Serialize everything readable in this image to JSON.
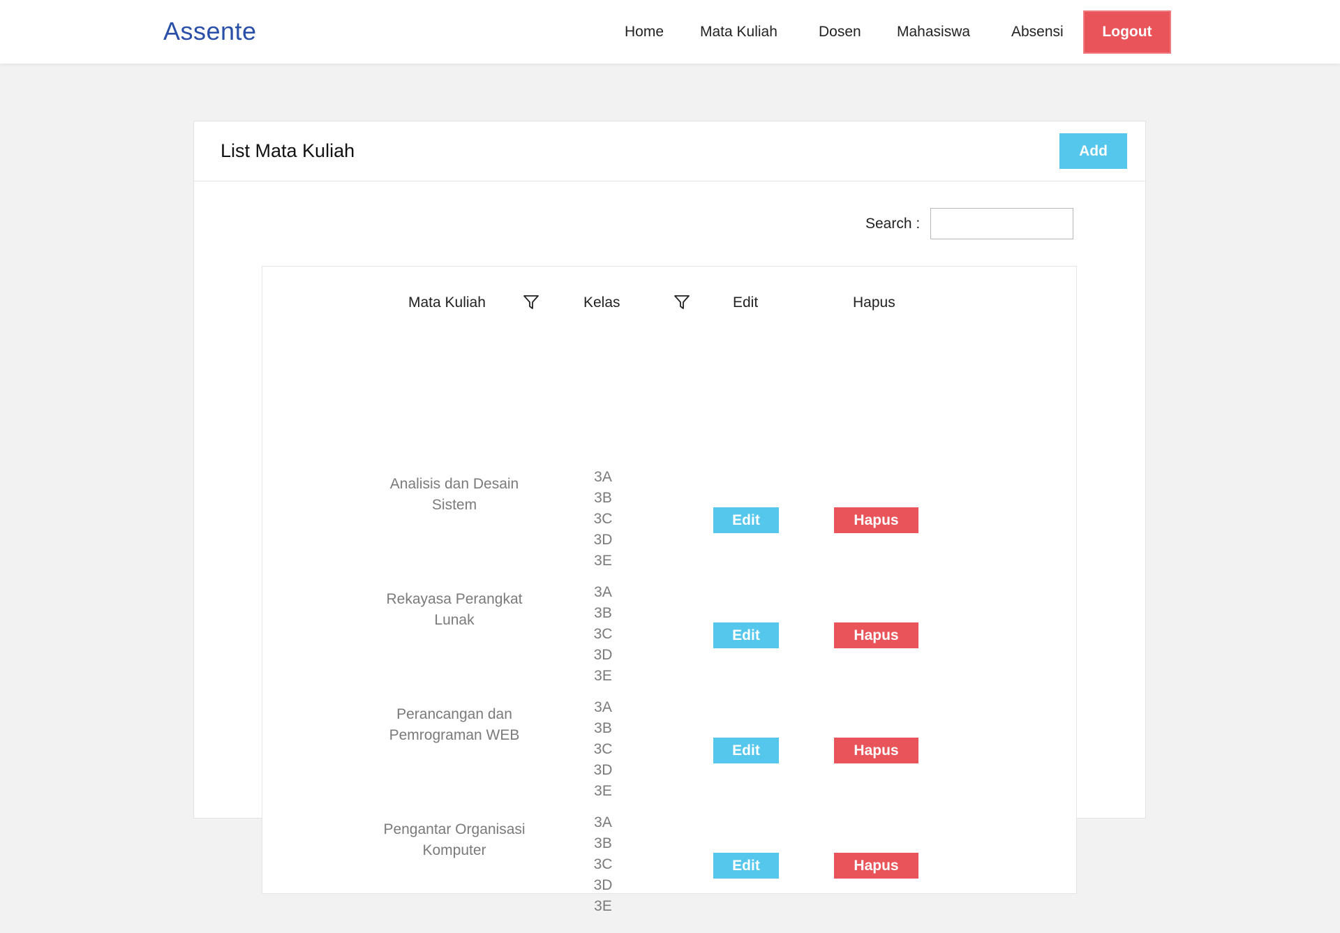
{
  "navbar": {
    "brand": "Assente",
    "items": [
      {
        "label": "Home"
      },
      {
        "label": "Mata Kuliah"
      },
      {
        "label": "Dosen"
      },
      {
        "label": "Mahasiswa"
      },
      {
        "label": "Absensi"
      }
    ],
    "logout_label": "Logout"
  },
  "card": {
    "title": "List Mata Kuliah",
    "add_label": "Add"
  },
  "search": {
    "label": "Search :",
    "value": "",
    "placeholder": ""
  },
  "table": {
    "headers": {
      "mata_kuliah": "Mata Kuliah",
      "kelas": "Kelas",
      "edit": "Edit",
      "hapus": "Hapus"
    },
    "rows": [
      {
        "name_line1": "Analisis dan Desain",
        "name_line2": "Sistem",
        "kelas": [
          "3A",
          "3B",
          "3C",
          "3D",
          "3E"
        ],
        "edit_label": "Edit",
        "hapus_label": "Hapus"
      },
      {
        "name_line1": "Rekayasa Perangkat",
        "name_line2": "Lunak",
        "kelas": [
          "3A",
          "3B",
          "3C",
          "3D",
          "3E"
        ],
        "edit_label": "Edit",
        "hapus_label": "Hapus"
      },
      {
        "name_line1": "Perancangan dan",
        "name_line2": "Pemrograman WEB",
        "kelas": [
          "3A",
          "3B",
          "3C",
          "3D",
          "3E"
        ],
        "edit_label": "Edit",
        "hapus_label": "Hapus"
      },
      {
        "name_line1": "Pengantar Organisasi",
        "name_line2": "Komputer",
        "kelas": [
          "3A",
          "3B",
          "3C",
          "3D",
          "3E"
        ],
        "edit_label": "Edit",
        "hapus_label": "Hapus"
      }
    ]
  },
  "icons": {
    "filter": "filter-icon"
  },
  "colors": {
    "brand": "#2a4fa8",
    "logout": "#e9545a",
    "primary_button": "#55c6ec",
    "danger_button": "#e9545a",
    "background": "#f2f2f2"
  }
}
